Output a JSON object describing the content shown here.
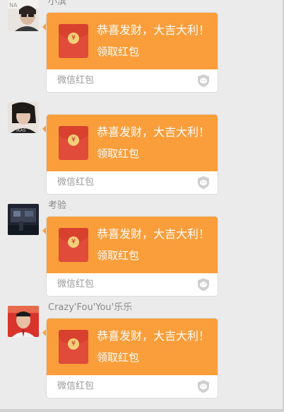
{
  "colors": {
    "bubble_orange": "#fa9d3b",
    "envelope_red": "#e14b3a",
    "background": "#ebebeb",
    "brand_text": "#9a9a9a"
  },
  "messages": [
    {
      "sender": "小滨",
      "avatar": "avatar-photo-man-glasses",
      "packet": {
        "coin_symbol": "¥",
        "greeting": "恭喜发财，大吉大利！",
        "claim": "领取红包",
        "brand": "微信红包",
        "brand_icon": "wechat-shield-icon"
      }
    },
    {
      "sender": "",
      "avatar": "avatar-photo-woman",
      "packet": {
        "coin_symbol": "¥",
        "greeting": "恭喜发财，大吉大利！",
        "claim": "领取红包",
        "brand": "微信红包",
        "brand_icon": "wechat-shield-icon"
      }
    },
    {
      "sender": "考验",
      "avatar": "avatar-photo-dark-room",
      "packet": {
        "coin_symbol": "¥",
        "greeting": "恭喜发财，大吉大利！",
        "claim": "领取红包",
        "brand": "微信红包",
        "brand_icon": "wechat-shield-icon"
      }
    },
    {
      "sender": "Crazy'Fou'You'乐乐",
      "avatar": "avatar-photo-man-red",
      "packet": {
        "coin_symbol": "¥",
        "greeting": "恭喜发财，大吉大利！",
        "claim": "领取红包",
        "brand": "微信红包",
        "brand_icon": "wechat-shield-icon"
      }
    }
  ]
}
